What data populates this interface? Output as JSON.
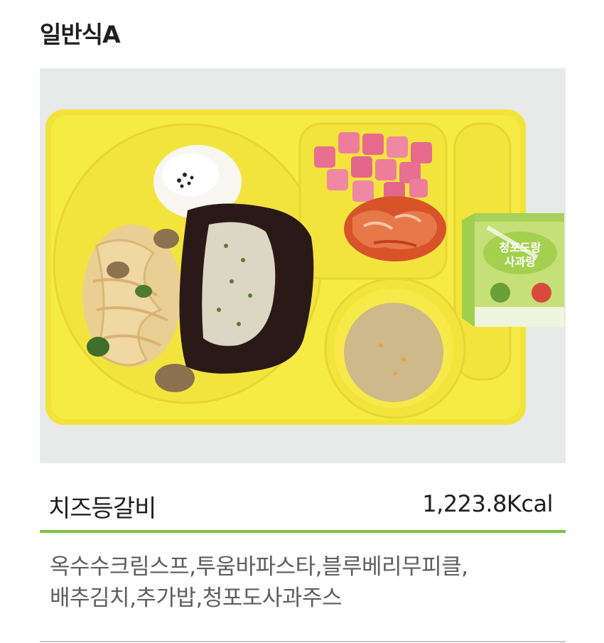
{
  "meal": {
    "title": "일반식A",
    "dish_name": "치즈등갈비",
    "calories": "1,223.8Kcal",
    "menu_line1": "옥수수크림스프,투움바파스타,블루베리무피클,",
    "menu_line2": "배추김치,추가밥,청포도사과주스"
  },
  "juice_box": {
    "title_line1": "청포도랑",
    "title_line2": "사과랑"
  },
  "colors": {
    "accent": "#7cc242",
    "tray": "#f5ea3f",
    "text_muted": "#5e5e5e"
  }
}
